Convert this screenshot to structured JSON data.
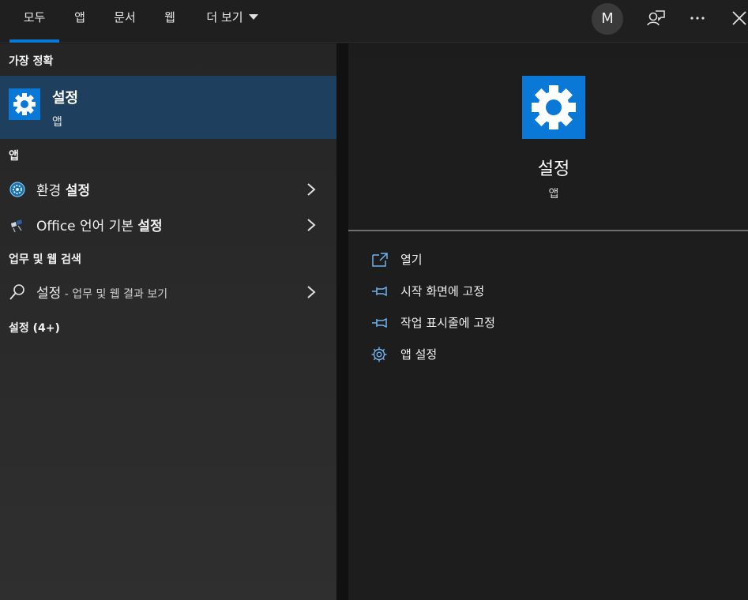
{
  "tabs": [
    "모두",
    "앱",
    "문서",
    "웹",
    "더 보기"
  ],
  "avatar_letter": "M",
  "left": {
    "best_match_header": "가장 정확",
    "best_match": {
      "name": "설정",
      "type": "앱",
      "icon": "settings-gear-icon"
    },
    "apps_header": "앱",
    "apps": [
      {
        "prefix": "환경 ",
        "bold": "설정",
        "icon": "control-panel-icon"
      },
      {
        "prefix": "Office 언어 기본 ",
        "bold": "설정",
        "icon": "office-language-icon"
      }
    ],
    "web_header": "업무 및 웹 검색",
    "web_item": {
      "label": "설정",
      "sub": " - 업무 및 웹 결과 보기",
      "icon": "search-icon"
    },
    "more_header": "설정 (4+)"
  },
  "right": {
    "name": "설정",
    "type": "앱",
    "actions": [
      {
        "label": "열기",
        "icon": "open-icon"
      },
      {
        "label": "시작 화면에 고정",
        "icon": "pin-icon"
      },
      {
        "label": "작업 표시줄에 고정",
        "icon": "pin-icon"
      },
      {
        "label": "앱 설정",
        "icon": "gear-outline-icon"
      }
    ]
  },
  "colors": {
    "accent": "#0a78d7",
    "selected_bg": "#1f3f5f",
    "background": "#1c1c1c"
  }
}
